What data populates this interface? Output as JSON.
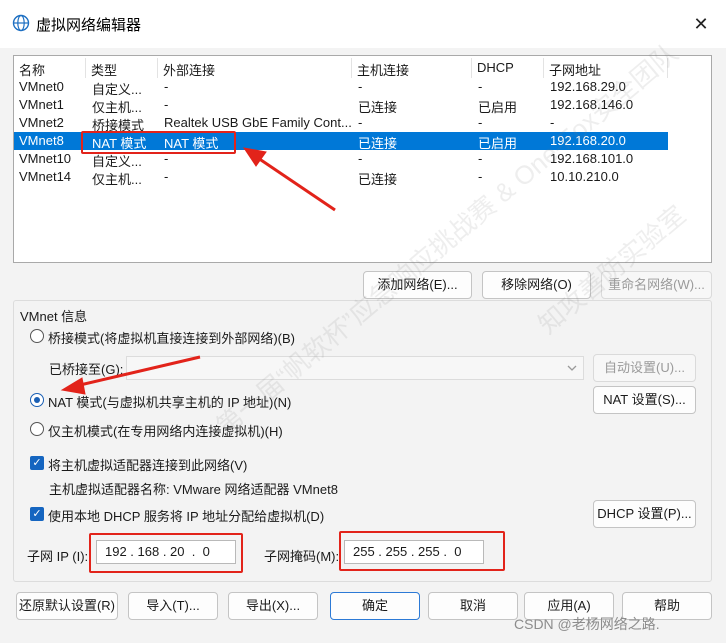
{
  "window": {
    "title": "虚拟网络编辑器",
    "close_label": "✕"
  },
  "network_list": {
    "headers": [
      "名称",
      "类型",
      "外部连接",
      "主机连接",
      "DHCP",
      "子网地址"
    ],
    "rows": [
      [
        "VMnet0",
        "自定义...",
        "-",
        "-",
        "-",
        "192.168.29.0"
      ],
      [
        "VMnet1",
        "仅主机...",
        "-",
        "已连接",
        "已启用",
        "192.168.146.0"
      ],
      [
        "VMnet2",
        "桥接模式",
        "Realtek USB GbE Family Cont...",
        "-",
        "-",
        "-"
      ],
      [
        "VMnet8",
        "NAT 模式",
        "NAT 模式",
        "已连接",
        "已启用",
        "192.168.20.0"
      ],
      [
        "VMnet10",
        "自定义...",
        "-",
        "-",
        "-",
        "192.168.101.0"
      ],
      [
        "VMnet14",
        "仅主机...",
        "-",
        "已连接",
        "-",
        "10.10.210.0"
      ]
    ],
    "selected_row": 3
  },
  "list_buttons": {
    "add": "添加网络(E)...",
    "remove": "移除网络(O)",
    "rename": "重命名网络(W)..."
  },
  "vmnet_info": {
    "label": "VMnet 信息",
    "bridge_mode": "桥接模式(将虚拟机直接连接到外部网络)(B)",
    "bridged_to_label": "已桥接至(G):",
    "auto_settings": "自动设置(U)...",
    "nat_mode": "NAT 模式(与虚拟机共享主机的 IP 地址)(N)",
    "nat_settings": "NAT 设置(S)...",
    "host_only": "仅主机模式(在专用网络内连接虚拟机)(H)",
    "connect_adapter": "将主机虚拟适配器连接到此网络(V)",
    "adapter_name": "主机虚拟适配器名称: VMware 网络适配器 VMnet8",
    "use_dhcp": "使用本地 DHCP 服务将 IP 地址分配给虚拟机(D)",
    "dhcp_settings": "DHCP 设置(P)...",
    "subnet_ip_label": "子网 IP (I):",
    "subnet_ip": "192 . 168 . 20  .  0",
    "subnet_mask_label": "子网掩码(M):",
    "subnet_mask": "255 . 255 . 255 .  0"
  },
  "footer": {
    "restore": "还原默认设置(R)",
    "import": "导入(T)...",
    "export": "导出(X)...",
    "ok": "确定",
    "cancel": "取消",
    "apply": "应用(A)",
    "help": "帮助"
  },
  "watermark": {
    "csdn": "CSDN @老杨网络之路.",
    "texts": [
      "第一届“帆软杯”应急响应挑战赛 & One-Fox安全团队",
      "知攻善防实验室"
    ]
  },
  "colors": {
    "selection": "#0078d7",
    "annotation_red": "#e2231a",
    "check_blue": "#1565c0"
  }
}
